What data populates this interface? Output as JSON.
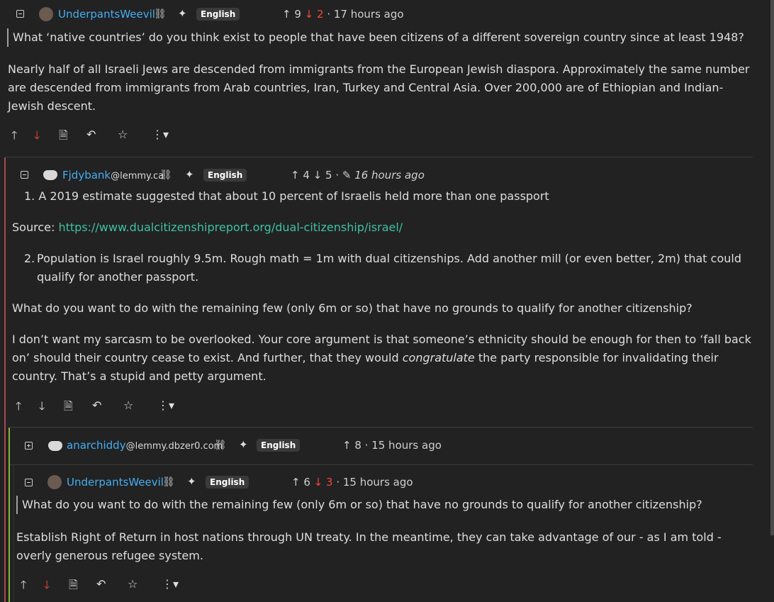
{
  "comments": [
    {
      "user": "UnderpantsWeevil",
      "instance": "",
      "language": "English",
      "up": "9",
      "down": "2",
      "time": "17 hours ago",
      "quote": "What ‘native countries’ do you think exist to people that have been citizens of a different sovereign country since at least 1948?",
      "body": "Nearly half of all Israeli Jews are descended from immigrants from the European Jewish diaspora. Approximately the same number are descended from immigrants from Arab countries, Iran, Turkey and Central Asia. Over 200,000 are of Ethiopian and Indian-Jewish descent."
    },
    {
      "user": "Fjdybank",
      "instance": "@lemmy.ca",
      "language": "English",
      "up": "4",
      "down": "5",
      "time": "16 hours ago",
      "item1": "A 2019 estimate suggested that about 10 percent of Israelis held more than one passport",
      "source_label": "Source:",
      "source_url": "https://www.dualcitizenshipreport.org/dual-citizenship/israel/",
      "item2": "Population is Israel roughly 9.5m. Rough math = 1m with dual citizenships. Add another mill (or even better, 2m) that could qualify for another passport.",
      "para3": "What do you want to do with the remaining few (only 6m or so) that have no grounds to qualify for another citizenship?",
      "para4_a": "I don’t want my sarcasm to be overlooked. Your core argument is that someone’s ethnicity should be enough for then to ‘fall back on’ should their country cease to exist. And further, that they would ",
      "para4_em": "congratulate",
      "para4_b": " the party responsible for invalidating their country. That’s a stupid and petty argument."
    },
    {
      "user": "anarchiddy",
      "instance": "@lemmy.dbzer0.com",
      "language": "English",
      "up": "8",
      "time": "15 hours ago"
    },
    {
      "user": "UnderpantsWeevil",
      "instance": "",
      "language": "English",
      "up": "6",
      "down": "3",
      "time": "15 hours ago",
      "quote": "What do you want to do with the remaining few (only 6m or so) that have no grounds to qualify for another citizenship?",
      "body": "Establish Right of Return in host nations through UN treaty. In the meantime, they can take advantage of our - as I am told - overly generous refugee system."
    }
  ],
  "num1": "1.",
  "num2": "2.",
  "icons": [
    "upvote-icon",
    "downvote-icon",
    "view-source-icon",
    "reply-icon",
    "save-star-icon",
    "more-options-icon"
  ],
  "colors": {
    "background": "#222222",
    "link": "#45aef1",
    "downvote": "#f2483b",
    "source_link": "#3fc29f"
  }
}
